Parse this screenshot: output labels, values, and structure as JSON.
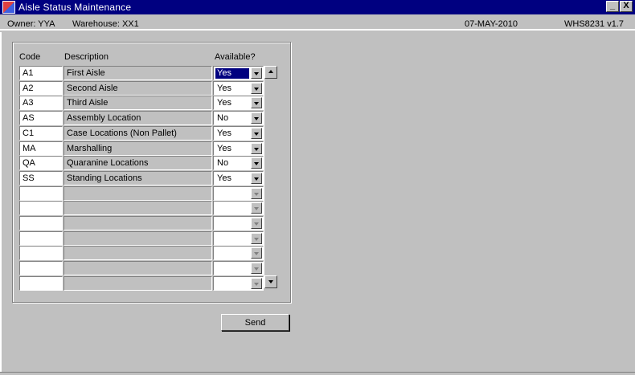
{
  "window": {
    "title": "Aisle Status Maintenance",
    "icon": "app-flag-icon",
    "minimize_glyph": "_",
    "close_glyph": "X"
  },
  "status": {
    "owner": "Owner:  YYA",
    "warehouse": "Warehouse:  XX1",
    "date": "07-MAY-2010",
    "program": "WHS8231  v1.7"
  },
  "table": {
    "headers": {
      "code": "Code",
      "description": "Description",
      "available": "Available?"
    },
    "rows": [
      {
        "code": "A1",
        "description": "First Aisle",
        "available": "Yes",
        "selected": true
      },
      {
        "code": "A2",
        "description": "Second Aisle",
        "available": "Yes"
      },
      {
        "code": "A3",
        "description": "Third Aisle",
        "available": "Yes"
      },
      {
        "code": "AS",
        "description": "Assembly Location",
        "available": "No"
      },
      {
        "code": "C1",
        "description": "Case Locations (Non Pallet)",
        "available": "Yes"
      },
      {
        "code": "MA",
        "description": "Marshalling",
        "available": "Yes"
      },
      {
        "code": "QA",
        "description": "Quaranine Locations",
        "available": "No"
      },
      {
        "code": "SS",
        "description": "Standing Locations",
        "available": "Yes"
      },
      {
        "code": "",
        "description": "",
        "available": ""
      },
      {
        "code": "",
        "description": "",
        "available": ""
      },
      {
        "code": "",
        "description": "",
        "available": ""
      },
      {
        "code": "",
        "description": "",
        "available": ""
      },
      {
        "code": "",
        "description": "",
        "available": ""
      },
      {
        "code": "",
        "description": "",
        "available": ""
      },
      {
        "code": "",
        "description": "",
        "available": ""
      }
    ]
  },
  "actions": {
    "send_label": "Send"
  }
}
